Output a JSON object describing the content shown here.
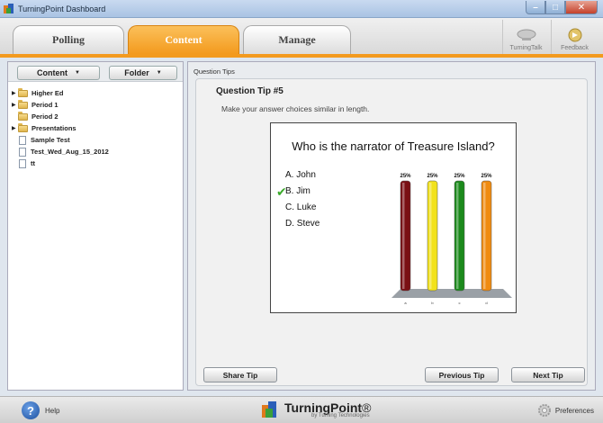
{
  "window": {
    "title": "TurningPoint Dashboard",
    "controls": [
      "–",
      "□",
      "✕"
    ]
  },
  "tabs": [
    {
      "label": "Polling"
    },
    {
      "label": "Content"
    },
    {
      "label": "Manage"
    }
  ],
  "tools": [
    {
      "label": "TurningTalk",
      "icon": "turningtalk-icon"
    },
    {
      "label": "Feedback",
      "icon": "feedback-icon"
    }
  ],
  "left": {
    "content_dropdown": "Content",
    "folder_dropdown": "Folder",
    "tree": [
      {
        "label": "Higher Ed",
        "type": "folder",
        "expandable": true
      },
      {
        "label": "Period 1",
        "type": "folder",
        "expandable": true
      },
      {
        "label": "Period 2",
        "type": "folder",
        "expandable": false
      },
      {
        "label": "Presentations",
        "type": "folder",
        "expandable": true
      },
      {
        "label": "Sample Test",
        "type": "file",
        "expandable": false
      },
      {
        "label": "Test_Wed_Aug_15_2012",
        "type": "file",
        "expandable": false
      },
      {
        "label": "tt",
        "type": "file",
        "expandable": false
      }
    ]
  },
  "right": {
    "section_label": "Question Tips",
    "tip_title": "Question Tip #5",
    "tip_description": "Make your answer choices similar in length.",
    "slide": {
      "question": "Who is the narrator of Treasure Island?",
      "answers": [
        "A. John",
        "B. Jim",
        "C. Luke",
        "D. Steve"
      ],
      "correct_index": 1
    },
    "buttons": {
      "share": "Share Tip",
      "previous": "Previous Tip",
      "next": "Next Tip"
    }
  },
  "chart_data": {
    "type": "bar",
    "categories": [
      "a",
      "b",
      "c",
      "d"
    ],
    "values": [
      25,
      25,
      25,
      25
    ],
    "data_labels": [
      "25%",
      "25%",
      "25%",
      "25%"
    ],
    "colors": [
      "#7a0f14",
      "#f2e21c",
      "#1c8a1c",
      "#f08b10"
    ],
    "ylim": [
      0,
      25
    ]
  },
  "footer": {
    "help": "Help",
    "brand": "TurningPoint",
    "brand_suffix": "®",
    "brand_by": "by Turning Technologies",
    "preferences": "Preferences"
  }
}
